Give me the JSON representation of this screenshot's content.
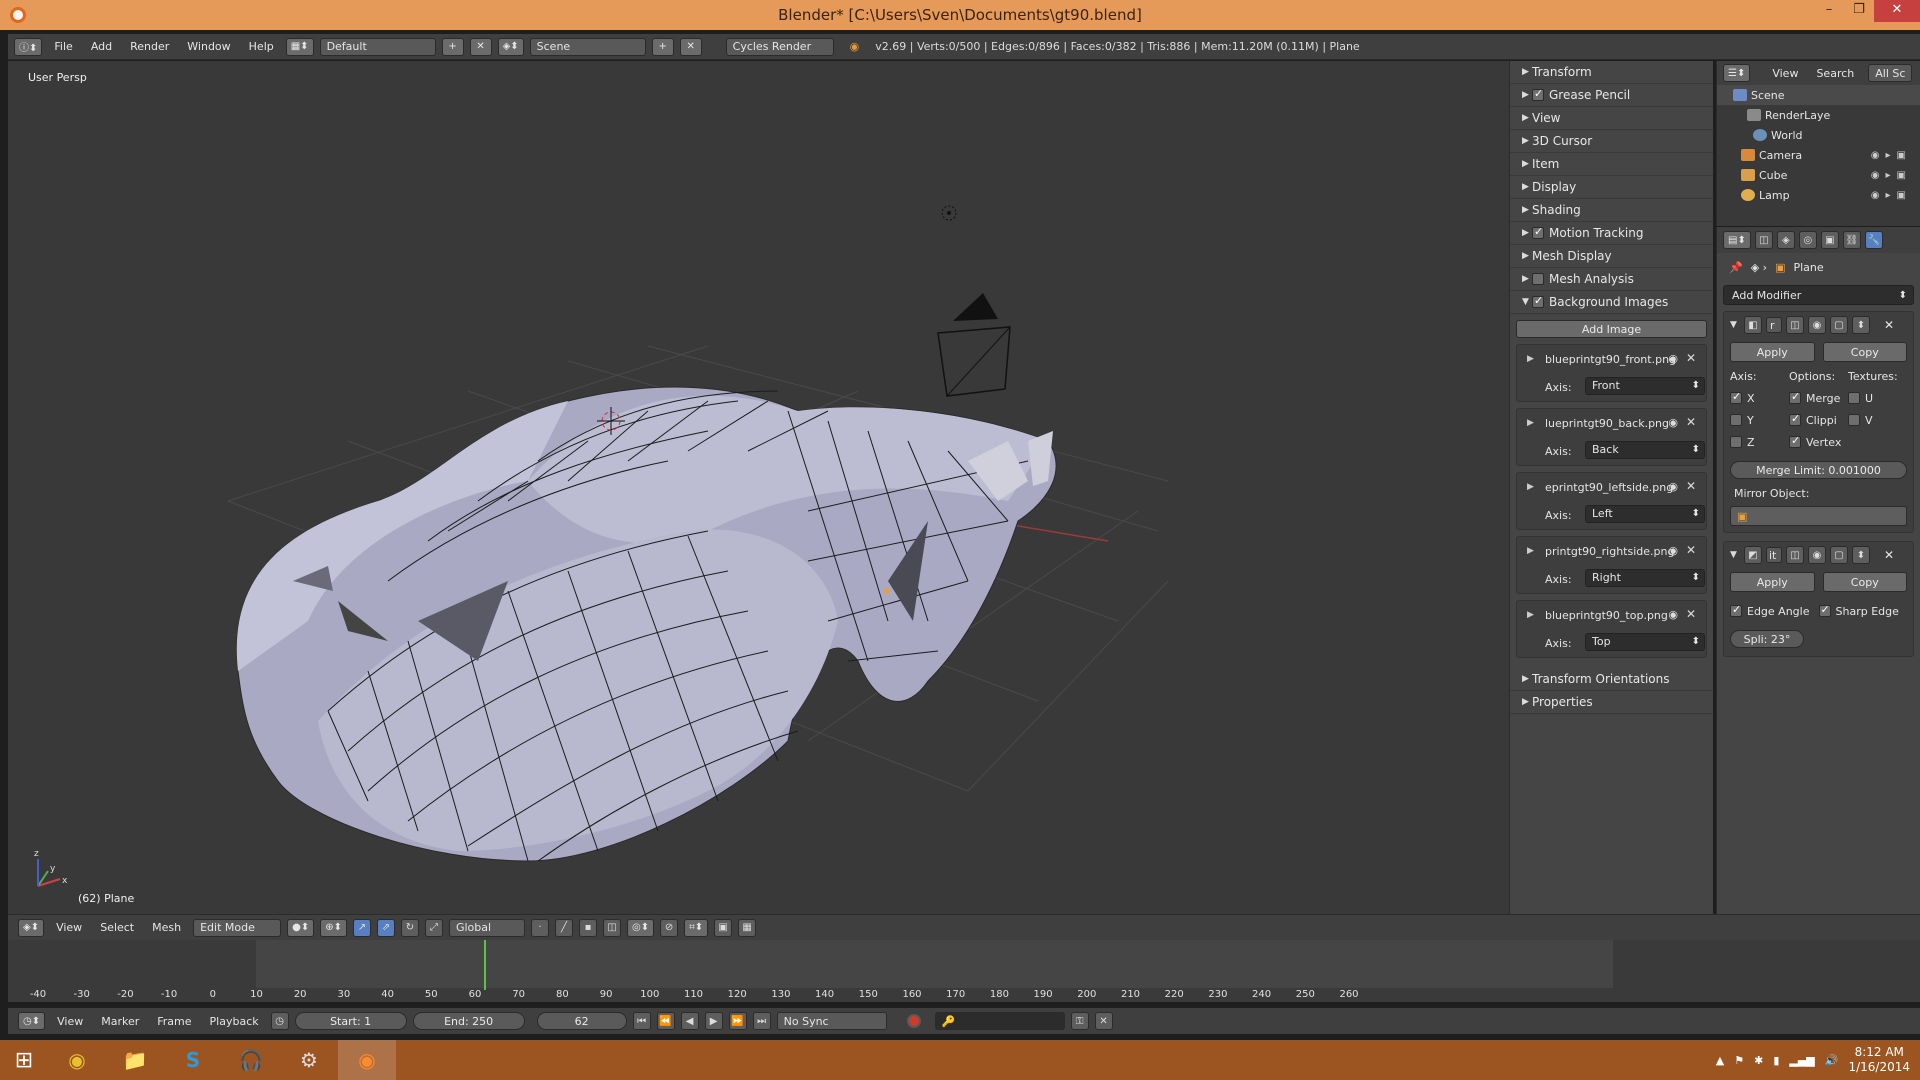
{
  "window": {
    "title": "Blender* [C:\\Users\\Sven\\Documents\\gt90.blend]",
    "minimize": "–",
    "maximize": "❐",
    "close": "✕"
  },
  "info_header": {
    "menus": [
      "File",
      "Add",
      "Render",
      "Window",
      "Help"
    ],
    "layout": "Default",
    "scene": "Scene",
    "engine": "Cycles Render",
    "stats": "v2.69 | Verts:0/500 | Edges:0/896 | Faces:0/382 | Tris:886 | Mem:11.20M (0.11M) | Plane"
  },
  "viewport": {
    "view_label": "User Persp",
    "object_label": "(62) Plane",
    "axis_x": "x",
    "axis_y": "y",
    "axis_z": "z"
  },
  "npanel": {
    "sections": [
      "Transform",
      "Grease Pencil",
      "View",
      "3D Cursor",
      "Item",
      "Display",
      "Shading",
      "Motion Tracking",
      "Mesh Display",
      "Mesh Analysis",
      "Background Images"
    ],
    "add_image": "Add Image",
    "axis_label": "Axis:",
    "images": [
      {
        "name": "blueprintgt90_front.png",
        "axis": "Front"
      },
      {
        "name": "lueprintgt90_back.png",
        "axis": "Back"
      },
      {
        "name": "eprintgt90_leftside.png",
        "axis": "Left"
      },
      {
        "name": "printgt90_rightside.png",
        "axis": "Right"
      },
      {
        "name": "blueprintgt90_top.png",
        "axis": "Top"
      }
    ],
    "bottom_sections": [
      "Transform Orientations",
      "Properties"
    ]
  },
  "outliner": {
    "menus": [
      "View",
      "Search"
    ],
    "filter": "All Sc",
    "rows": [
      "Scene",
      "RenderLaye",
      "World",
      "Camera",
      "Cube",
      "Lamp"
    ]
  },
  "properties": {
    "context_object": "Plane",
    "add_modifier": "Add Modifier",
    "mirror": {
      "name": "r",
      "apply": "Apply",
      "copy": "Copy",
      "axis_header": "Axis:",
      "options_header": "Options:",
      "textures_header": "Textures:",
      "axes": [
        "X",
        "Y",
        "Z"
      ],
      "options": [
        "Merge",
        "Clippi",
        "Vertex"
      ],
      "textures": [
        "U",
        "V"
      ],
      "merge_limit": "Merge Limit: 0.001000",
      "mirror_object": "Mirror Object:"
    },
    "edge_split": {
      "name": "it",
      "apply": "Apply",
      "copy": "Copy",
      "edge_angle": "Edge Angle",
      "sharp_edge": "Sharp Edge",
      "split_angle": "Spli: 23°"
    }
  },
  "view3d_header": {
    "menus": [
      "View",
      "Select",
      "Mesh"
    ],
    "mode": "Edit Mode",
    "orientation": "Global"
  },
  "timeline": {
    "ticks": [
      "-40",
      "-30",
      "-20",
      "-10",
      "0",
      "10",
      "20",
      "30",
      "40",
      "50",
      "60",
      "70",
      "80",
      "90",
      "100",
      "110",
      "120",
      "130",
      "140",
      "150",
      "160",
      "170",
      "180",
      "190",
      "200",
      "210",
      "220",
      "230",
      "240",
      "250",
      "260"
    ],
    "current_frame_value": 62
  },
  "timeline_header": {
    "menus": [
      "View",
      "Marker",
      "Frame",
      "Playback"
    ],
    "start": "Start: 1",
    "end": "End: 250",
    "current": "62",
    "sync": "No Sync"
  },
  "taskbar": {
    "time": "8:12 AM",
    "date": "1/16/2014"
  },
  "colors": {
    "title_bar": "#e59a5a",
    "taskbar": "#9c5420",
    "viewport_bg": "#393939",
    "current_frame": "#5fbf4f",
    "active_tool": "#5680c2"
  }
}
